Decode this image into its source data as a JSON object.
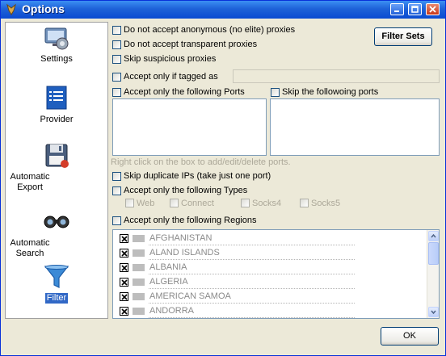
{
  "window": {
    "title": "Options"
  },
  "sidebar": {
    "items": [
      {
        "label": "Settings",
        "icon": "settings-icon"
      },
      {
        "label": "Provider",
        "icon": "provider-icon"
      },
      {
        "label": "Automatic Export",
        "icon": "floppy-icon"
      },
      {
        "label": "Automatic Search",
        "icon": "binoculars-icon"
      },
      {
        "label": "Filter",
        "icon": "funnel-icon",
        "active": true
      }
    ]
  },
  "filter": {
    "no_anonymous": "Do not accept anonymous (no elite) proxies",
    "no_transparent": "Do not accept transparent proxies",
    "skip_suspicious": "Skip suspicious proxies",
    "filter_sets_button": "Filter Sets",
    "tagged_as": "Accept only if tagged as",
    "tagged_value": "",
    "ports_accept": "Accept only the following Ports",
    "ports_skip": "Skip the followoing ports",
    "ports_hint": "Right click on the box to add/edit/delete ports.",
    "skip_duplicate": "Skip duplicate IPs (take just one port)",
    "types_accept": "Accept only the following Types",
    "types": [
      "Web",
      "Connect",
      "Socks4",
      "Socks5"
    ],
    "regions_accept": "Accept only the following Regions",
    "regions": [
      "AFGHANISTAN",
      "ALAND ISLANDS",
      "ALBANIA",
      "ALGERIA",
      "AMERICAN SAMOA",
      "ANDORRA"
    ]
  },
  "footer": {
    "ok_button": "OK"
  }
}
